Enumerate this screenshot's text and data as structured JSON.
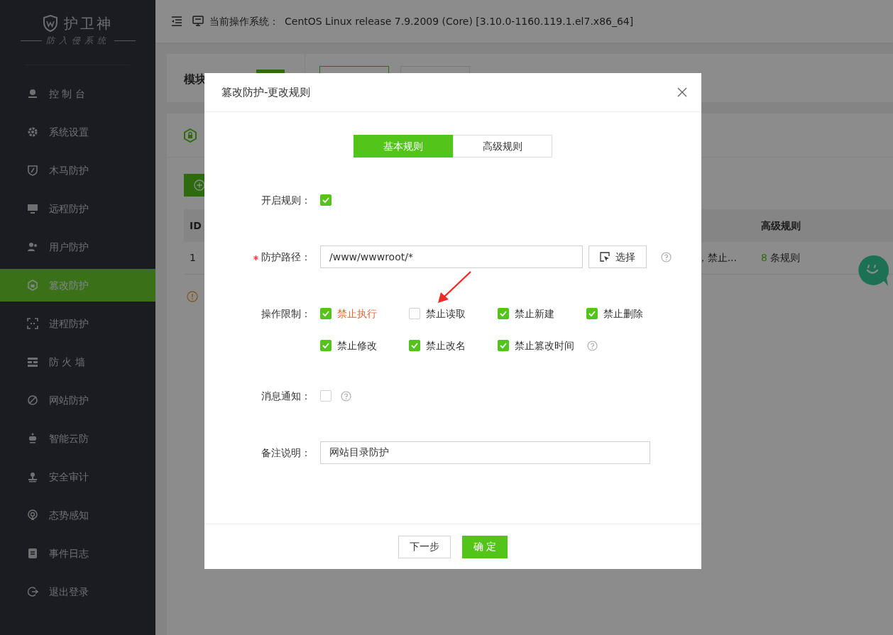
{
  "sidebar": {
    "logo": {
      "title": "护卫神",
      "subtitle": "防入侵系统"
    },
    "items": [
      {
        "label": "控 制 台",
        "selected": false
      },
      {
        "label": "系统设置",
        "selected": false
      },
      {
        "label": "木马防护",
        "selected": false
      },
      {
        "label": "远程防护",
        "selected": false
      },
      {
        "label": "用户防护",
        "selected": false
      },
      {
        "label": "篡改防护",
        "selected": true
      },
      {
        "label": "进程防护",
        "selected": false
      },
      {
        "label": "防 火 墙",
        "selected": false
      },
      {
        "label": "网站防护",
        "selected": false
      },
      {
        "label": "智能云防",
        "selected": false
      },
      {
        "label": "安全审计",
        "selected": false
      },
      {
        "label": "态势感知",
        "selected": false
      },
      {
        "label": "事件日志",
        "selected": false
      },
      {
        "label": "退出登录",
        "selected": false
      }
    ]
  },
  "header": {
    "os_label": "当前操作系统：",
    "os_value": "CentOS Linux release 7.9.2009 (Core) [3.10.0-1160.119.1.el7.x86_64]"
  },
  "module_card": {
    "title": "模块"
  },
  "table": {
    "columns": [
      {
        "label": "ID"
      },
      {
        "label": "高级规则"
      }
    ],
    "rows": [
      {
        "id": "1",
        "column_3": "，禁止...",
        "rule_count": "8",
        "rule_suffix": "条规则"
      }
    ]
  },
  "modal": {
    "title": "篡改防护-更改规则",
    "tabs": [
      {
        "label": "基本规则",
        "selected": true
      },
      {
        "label": "高级规则",
        "selected": false
      }
    ],
    "enable_rule": {
      "label": "开启规则：",
      "checked": true
    },
    "path": {
      "label": "防护路径：",
      "required": true,
      "value": "/www/wwwroot/*",
      "button": "选择"
    },
    "restrictions": {
      "label": "操作限制：",
      "options": [
        {
          "label": "禁止执行",
          "checked": true,
          "color": "#e8652f"
        },
        {
          "label": "禁止读取",
          "checked": false,
          "color": "#333333"
        },
        {
          "label": "禁止新建",
          "checked": true,
          "color": "#333333"
        },
        {
          "label": "禁止删除",
          "checked": true,
          "color": "#333333"
        },
        {
          "label": "禁止修改",
          "checked": true,
          "color": "#333333"
        },
        {
          "label": "禁止改名",
          "checked": true,
          "color": "#333333"
        },
        {
          "label": "禁止篡改时间",
          "checked": true,
          "color": "#333333"
        }
      ]
    },
    "notify": {
      "label": "消息通知：",
      "checked": false
    },
    "remark": {
      "label": "备注说明：",
      "value": "网站目录防护"
    },
    "buttons": [
      {
        "label": "下一步",
        "kind": "default"
      },
      {
        "label": "确 定",
        "kind": "primary"
      }
    ]
  }
}
